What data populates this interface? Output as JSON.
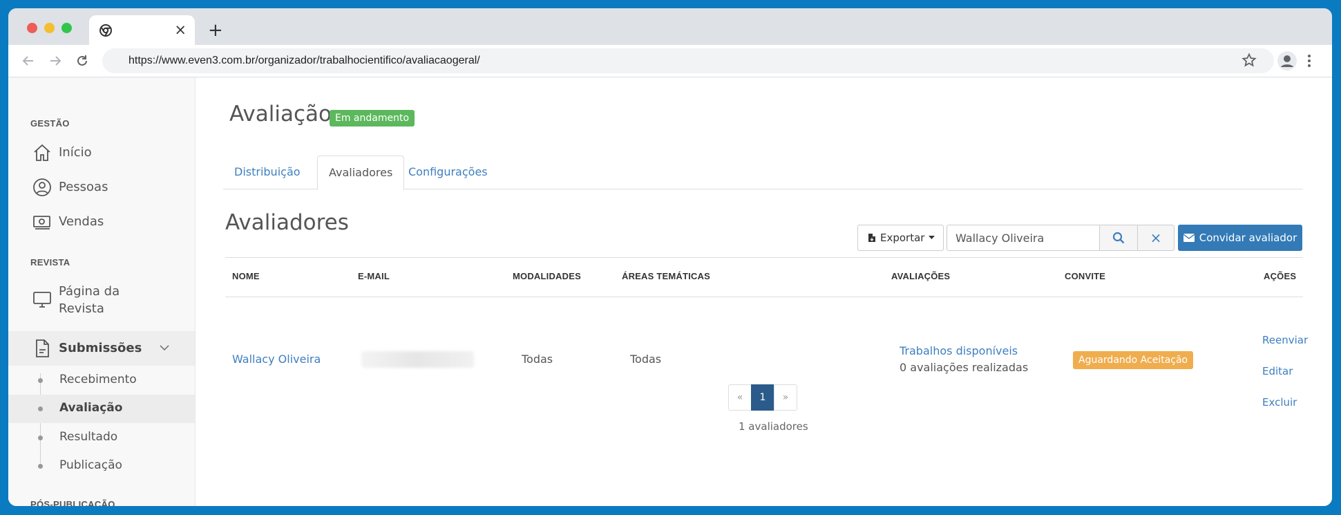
{
  "browser": {
    "url": "https://www.even3.com.br/organizador/trabalhocientifico/avaliacaogeral/",
    "tab_close": "×",
    "new_tab": "+"
  },
  "sidebar": {
    "section_gestao": "GESTÃO",
    "items_gestao": [
      {
        "label": "Início",
        "icon": "home-icon"
      },
      {
        "label": "Pessoas",
        "icon": "person-circle-icon"
      },
      {
        "label": "Vendas",
        "icon": "money-icon"
      }
    ],
    "section_revista": "REVISTA",
    "pagina_revista_line1": "Página da",
    "pagina_revista_line2": "Revista",
    "submissoes_label": "Submissões",
    "sub_items": [
      {
        "label": "Recebimento",
        "active": false
      },
      {
        "label": "Avaliação",
        "active": true
      },
      {
        "label": "Resultado",
        "active": false
      },
      {
        "label": "Publicação",
        "active": false
      }
    ],
    "section_pos": "PÓS-PUBLICAÇÃO"
  },
  "main": {
    "title": "Avaliação",
    "status_badge": "Em andamento",
    "tabs": [
      {
        "label": "Distribuição",
        "active": false
      },
      {
        "label": "Avaliadores",
        "active": true
      },
      {
        "label": "Configurações",
        "active": false
      }
    ],
    "section_title": "Avaliadores",
    "export_label": "Exportar",
    "search_value": "Wallacy Oliveira",
    "clear_label": "×",
    "invite_label": "Convidar avaliador",
    "table": {
      "headers": [
        "NOME",
        "E-MAIL",
        "MODALIDADES",
        "ÁREAS TEMÁTICAS",
        "AVALIAÇÕES",
        "CONVITE",
        "AÇÕES"
      ],
      "row": {
        "nome": "Wallacy Oliveira",
        "modalidades": "Todas",
        "areas": "Todas",
        "avaliacoes_link": "Trabalhos disponíveis",
        "avaliacoes_count": "0 avaliações realizadas",
        "convite": "Aguardando Aceitação",
        "acoes": [
          "Reenviar",
          "Editar",
          "Excluir"
        ]
      }
    },
    "pagination": {
      "prev": "«",
      "current": "1",
      "next": "»"
    },
    "count_text": "1 avaliadores"
  },
  "colors": {
    "link": "#3d7fc0",
    "success": "#5cb85c",
    "warning": "#f0ad4e",
    "primary": "#337ab7"
  }
}
